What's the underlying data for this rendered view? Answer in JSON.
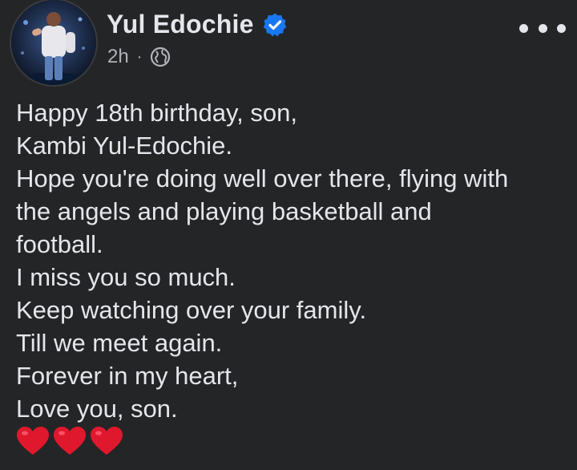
{
  "post": {
    "author": "Yul Edochie",
    "time": "2h",
    "separator": "·",
    "audience_icon": "globe-icon",
    "verified_icon": "verified-badge-icon",
    "more_icon": "more-options-icon",
    "lines": [
      "Happy 18th birthday, son,",
      "Kambi Yul-Edochie.",
      "Hope you're doing well over there, flying with",
      "the angels and playing basketball and",
      "football.",
      "I miss you so much.",
      "Keep watching over your family.",
      "Till we meet again.",
      "Forever in my heart,",
      "Love you, son."
    ],
    "emoji": [
      "red-heart-icon",
      "red-heart-icon",
      "red-heart-icon"
    ]
  },
  "colors": {
    "background": "#242526",
    "text": "#e4e6eb",
    "muted": "#b0b3b8",
    "verified_blue": "#1877f2",
    "heart_red": "#e0182d"
  }
}
